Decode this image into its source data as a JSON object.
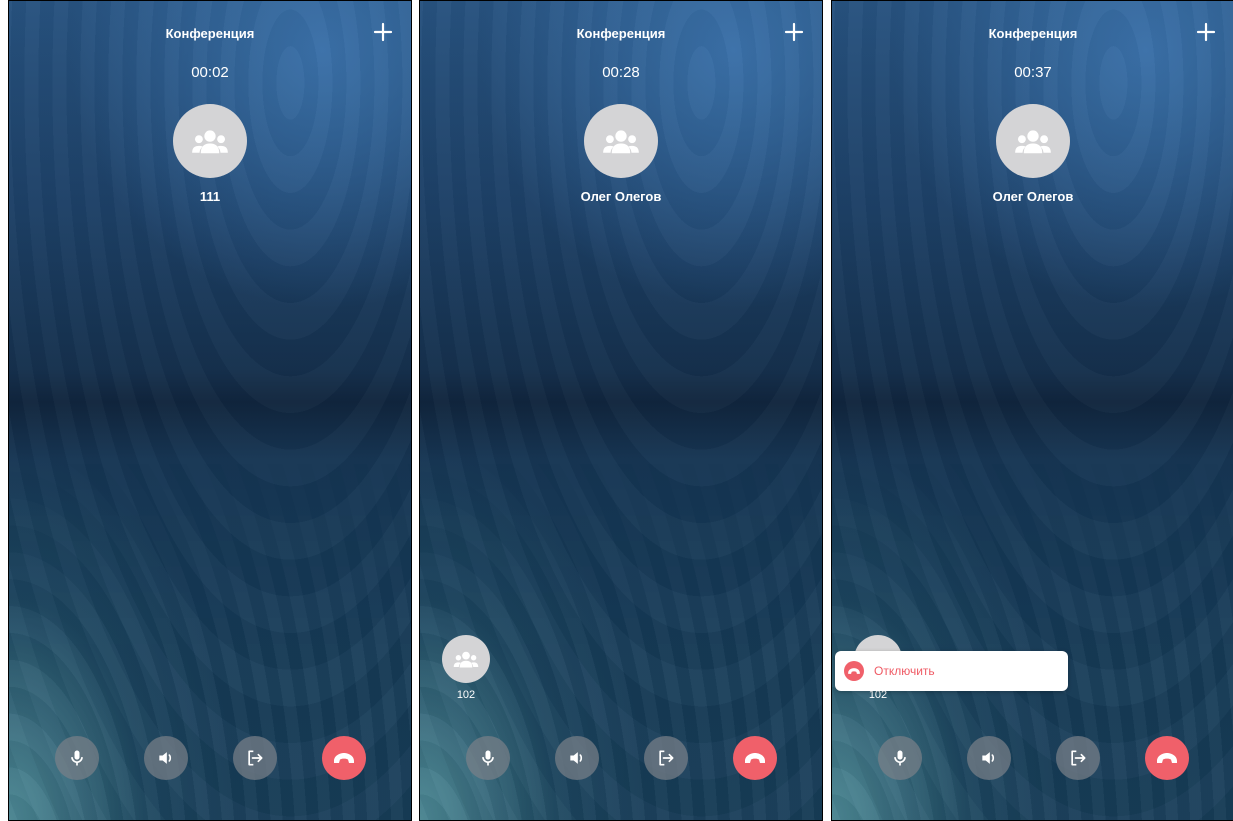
{
  "screens": [
    {
      "title": "Конференция",
      "timer": "00:02",
      "name": "111",
      "icons": {
        "add": "plus-icon",
        "avatar": "group-icon"
      },
      "controls": [
        "microphone-icon",
        "speaker-icon",
        "transfer-icon",
        "hangup-icon"
      ]
    },
    {
      "title": "Конференция",
      "timer": "00:28",
      "name": "Олег Олегов",
      "participant": {
        "label": "102"
      },
      "icons": {
        "add": "plus-icon",
        "avatar": "group-icon"
      },
      "controls": [
        "microphone-icon",
        "speaker-icon",
        "transfer-icon",
        "hangup-icon"
      ]
    },
    {
      "title": "Конференция",
      "timer": "00:37",
      "name": "Олег Олегов",
      "participant": {
        "label": "102"
      },
      "menu": {
        "disconnect_label": "Отключить"
      },
      "icons": {
        "add": "plus-icon",
        "avatar": "group-icon"
      },
      "controls": [
        "microphone-icon",
        "speaker-icon",
        "transfer-icon",
        "hangup-icon"
      ]
    }
  ],
  "colors": {
    "hangup": "#f0606a",
    "control_bg": "#787f88",
    "avatar_bg": "#d4d4d6",
    "text": "#ffffff",
    "menu_text": "#ef5a64"
  }
}
